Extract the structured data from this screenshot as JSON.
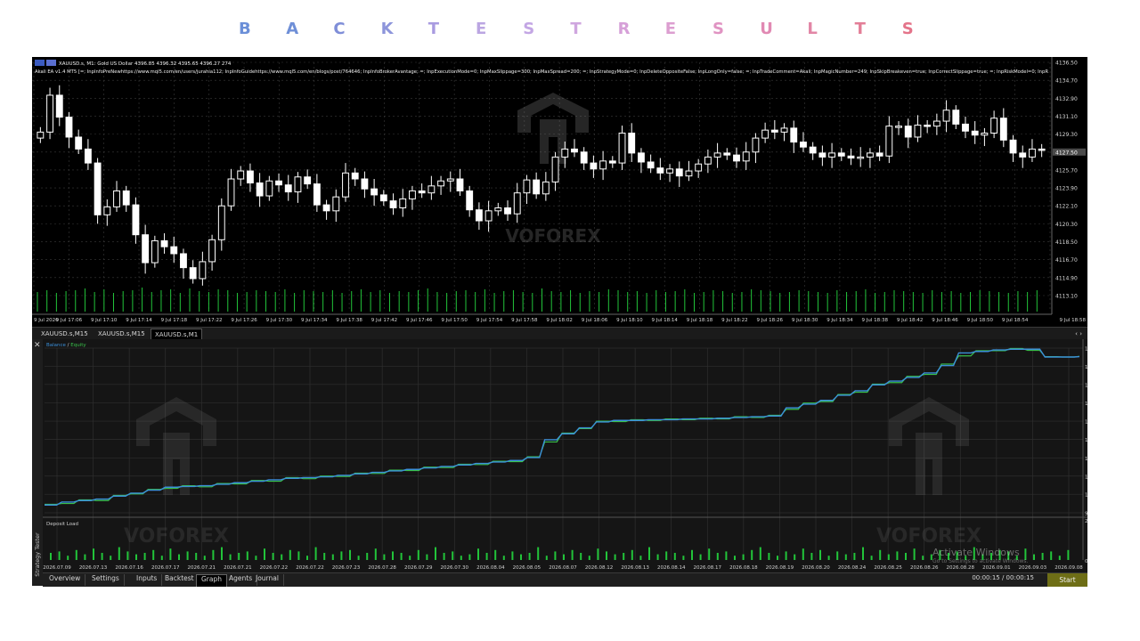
{
  "header": {
    "title_letters": [
      "B",
      "A",
      "C",
      "K",
      "T",
      "E",
      "S",
      "T",
      "R",
      "E",
      "S",
      "U",
      "L",
      "T",
      "S"
    ],
    "title_colors": [
      "#6b8fd8",
      "#6f8fd7",
      "#7f8ed8",
      "#8d95db",
      "#a99be0",
      "#bba6e2",
      "#c3a6e4",
      "#cfa6df",
      "#d6a0d8",
      "#dc9ed0",
      "#e093c2",
      "#e189b3",
      "#e286a6",
      "#e37e97",
      "#e4748a"
    ]
  },
  "price_chart": {
    "header_line1": "XAUUSD.s, M1:  Gold US Dollar  4396.85 4396.32 4395.65 4396.27  274",
    "header_line2": "Akali EA v1.4 MT5 [=; InpInfoPreNewhttps://www.mql5.com/en/users/jurahia112; InpInfoGuidehttps://www.mql5.com/en/blogs/post/764646; InpInfoBrokerAvantage; =; InpExecutionMode=0; InpMaxSlippage=300; InpMaxSpread=200; =; InpStrategyMode=0; InpDeleteOppositeFalse; InpLongOnly=false; =; InpTradeComment=Akali; InpMagicNumber=249; InpSkipBreakeven=true; InpCorrectSlippage=true; =; InpRiskModel=0; InpR",
    "price_labels": [
      "4136.50",
      "4134.70",
      "4132.90",
      "4131.10",
      "4129.30",
      "4127.50",
      "4125.70",
      "4123.90",
      "4122.10",
      "4120.30",
      "4118.50",
      "4116.70",
      "4114.90",
      "4113.10"
    ],
    "time_labels": [
      "9 Jul 2026",
      "9 Jul 17:06",
      "9 Jul 17:10",
      "9 Jul 17:14",
      "9 Jul 17:18",
      "9 Jul 17:22",
      "9 Jul 17:26",
      "9 Jul 17:30",
      "9 Jul 17:34",
      "9 Jul 17:38",
      "9 Jul 17:42",
      "9 Jul 17:46",
      "9 Jul 17:50",
      "9 Jul 17:54",
      "9 Jul 17:58",
      "9 Jul 18:02",
      "9 Jul 18:06",
      "9 Jul 18:10",
      "9 Jul 18:14",
      "9 Jul 18:18",
      "9 Jul 18:22",
      "9 Jul 18:26",
      "9 Jul 18:30",
      "9 Jul 18:34",
      "9 Jul 18:38",
      "9 Jul 18:42",
      "9 Jul 18:46",
      "9 Jul 18:50",
      "9 Jul 18:54",
      "9 Jul 18:58"
    ],
    "current_price": "4127.50",
    "watermark": "VOFOREX",
    "closes": [
      4129.5,
      4133.2,
      4131.0,
      4129.0,
      4127.8,
      4126.4,
      4121.2,
      4122.0,
      4123.6,
      4122.2,
      4119.2,
      4116.4,
      4118.6,
      4118.0,
      4117.3,
      4115.9,
      4114.8,
      4116.5,
      4118.7,
      4122.1,
      4124.8,
      4125.6,
      4124.4,
      4123.1,
      4124.6,
      4124.2,
      4123.5,
      4125.0,
      4124.3,
      4122.2,
      4121.6,
      4123.0,
      4125.4,
      4124.8,
      4123.8,
      4123.2,
      4122.6,
      4121.9,
      4122.8,
      4123.6,
      4123.4,
      4124.1,
      4124.6,
      4124.8,
      4123.6,
      4121.7,
      4120.6,
      4121.6,
      4121.9,
      4121.3,
      4123.4,
      4124.7,
      4123.3,
      4124.5,
      4127.0,
      4127.8,
      4127.5,
      4126.4,
      4125.8,
      4126.6,
      4126.4,
      4129.4,
      4127.4,
      4126.5,
      4125.9,
      4125.4,
      4125.8,
      4125.1,
      4125.6,
      4126.3,
      4127.0,
      4127.4,
      4127.2,
      4126.6,
      4127.5,
      4128.9,
      4129.7,
      4129.5,
      4129.9,
      4128.5,
      4128.0,
      4127.4,
      4127.0,
      4127.4,
      4127.1,
      4126.9,
      4127.0,
      4127.4,
      4127.1,
      4130.1,
      4130.1,
      4129.0,
      4130.2,
      4130.1,
      4130.6,
      4131.7,
      4130.3,
      4129.6,
      4129.2,
      4129.4,
      4130.9,
      4128.7,
      4127.4,
      4127.0,
      4127.8,
      4127.7
    ],
    "volumes": [
      22,
      24,
      21,
      23,
      24,
      26,
      22,
      25,
      21,
      23,
      24,
      27,
      22,
      24,
      25,
      21,
      26,
      23,
      22,
      25,
      24,
      21,
      22,
      24,
      23,
      22,
      25,
      21,
      24,
      23,
      22,
      24,
      21,
      23,
      25,
      22,
      24,
      21,
      23,
      22,
      24,
      26,
      22,
      21,
      23,
      24,
      22,
      25,
      21,
      23,
      24,
      22,
      21,
      26,
      23,
      22,
      24,
      21,
      23,
      22,
      25,
      24,
      22,
      23,
      21,
      24,
      22,
      23,
      25,
      21,
      22,
      24,
      23,
      21,
      22,
      25,
      24,
      23,
      21,
      22,
      24,
      23,
      22,
      21,
      24,
      22,
      23,
      25,
      21,
      22,
      24,
      23,
      22,
      21,
      24,
      22,
      23,
      21,
      22,
      24,
      23,
      22,
      21,
      23,
      22,
      24
    ]
  },
  "chart_tabs": [
    "XAUUSD.s,M15",
    "XAUUSD.s,M15",
    "XAUUSD.s,M1"
  ],
  "balance_chart": {
    "legend_balance": "Balance",
    "legend_sep": " / ",
    "legend_equity": "Equity",
    "y_labels": [
      "1423",
      "1374",
      "1325",
      "1275",
      "1226",
      "1177",
      "1127",
      "1078",
      "1029",
      "979"
    ],
    "deposit_title": "Deposit Load",
    "deposit_labels": [
      "25.0%",
      "0.0%"
    ],
    "x_labels": [
      "2026.07.09",
      "2026.07.13",
      "2026.07.16",
      "2026.07.17",
      "2026.07.21",
      "2026.07.21",
      "2026.07.22",
      "2026.07.22",
      "2026.07.23",
      "2026.07.28",
      "2026.07.29",
      "2026.07.30",
      "2026.08.04",
      "2026.08.05",
      "2026.08.07",
      "2026.08.12",
      "2026.08.13",
      "2026.08.14",
      "2026.08.17",
      "2026.08.18",
      "2026.08.19",
      "2026.08.20",
      "2026.08.24",
      "2026.08.25",
      "2026.08.26",
      "2026.08.28",
      "2026.09.01",
      "2026.09.03",
      "2026.09.08"
    ],
    "balance": [
      1000,
      1008,
      1012,
      1016,
      1024,
      1032,
      1040,
      1048,
      1050,
      1052,
      1056,
      1060,
      1064,
      1068,
      1072,
      1074,
      1076,
      1080,
      1084,
      1088,
      1092,
      1096,
      1100,
      1104,
      1108,
      1112,
      1116,
      1120,
      1128,
      1176,
      1192,
      1208,
      1224,
      1228,
      1228,
      1230,
      1230,
      1232,
      1232,
      1234,
      1236,
      1238,
      1240,
      1262,
      1272,
      1282,
      1296,
      1308,
      1324,
      1334,
      1344,
      1356,
      1376,
      1410,
      1414,
      1418,
      1420,
      1420,
      1399,
      1399,
      1400
    ],
    "equity": [
      1002,
      1004,
      1014,
      1012,
      1026,
      1030,
      1042,
      1045,
      1052,
      1049,
      1058,
      1057,
      1066,
      1064,
      1074,
      1071,
      1078,
      1077,
      1086,
      1085,
      1094,
      1093,
      1102,
      1101,
      1110,
      1109,
      1118,
      1117,
      1130,
      1170,
      1194,
      1206,
      1226,
      1225,
      1230,
      1228,
      1232,
      1230,
      1234,
      1232,
      1238,
      1236,
      1242,
      1258,
      1275,
      1279,
      1298,
      1304,
      1326,
      1330,
      1347,
      1352,
      1380,
      1402,
      1416,
      1416,
      1422,
      1417,
      1400,
      1399,
      1401
    ],
    "deposit_load": [
      5,
      6,
      3,
      7,
      4,
      8,
      5,
      3,
      9,
      6,
      4,
      5,
      7,
      3,
      8,
      4,
      6,
      5,
      3,
      7,
      9,
      4,
      5,
      6,
      3,
      8,
      5,
      4,
      7,
      6,
      3,
      9,
      5,
      4,
      6,
      7,
      3,
      5,
      8,
      4,
      6,
      5,
      3,
      7,
      4,
      9,
      5,
      6,
      3,
      4,
      8,
      5,
      7,
      3,
      6,
      4,
      5,
      9,
      3,
      6,
      4,
      7,
      5,
      3,
      8,
      6,
      4,
      5,
      7,
      3,
      9,
      4,
      6,
      5,
      3,
      7,
      4,
      8,
      5,
      6,
      3,
      4,
      7,
      9,
      5,
      3,
      6,
      4,
      8,
      5,
      7,
      3,
      6,
      4,
      5,
      9,
      3,
      7,
      4,
      6,
      5,
      8,
      3,
      4,
      7,
      5,
      6,
      3,
      9,
      4,
      5,
      7,
      6,
      3,
      8,
      4,
      5,
      6,
      3,
      7
    ],
    "watermark": "VOFOREX"
  },
  "bottom_tabs": [
    "Overview",
    "Settings",
    "Inputs",
    "Backtest",
    "Graph",
    "Agents",
    "Journal"
  ],
  "side_label": "Strategy Tester",
  "time_text": "00:00:15 / 00:00:15",
  "start_label": "Start",
  "activate": {
    "line1": "Activate Windows",
    "line2": "Go to Settings to activate Windows."
  },
  "colors": {
    "bull": "#ffffff",
    "bear": "#ffffff",
    "volume": "#22c43a",
    "grid": "#3a3a3a",
    "balance": "#3b8fd9",
    "equity": "#39c04a",
    "start_button": "#6e6e16"
  }
}
